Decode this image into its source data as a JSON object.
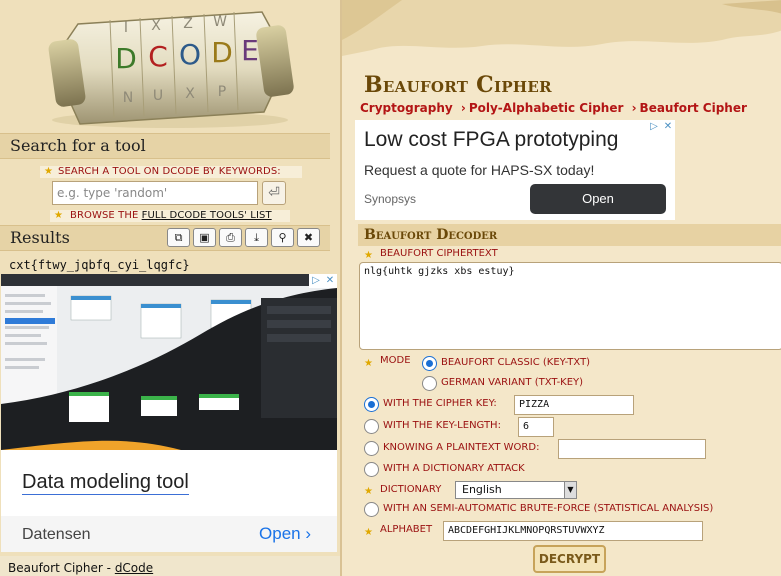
{
  "left": {
    "logo_text": "DCODE",
    "search_section": "Search for a tool",
    "search_keywords_label": "SEARCH A TOOL ON DCODE BY KEYWORDS:",
    "search_placeholder": "e.g. type 'random'",
    "browse_prefix": "BROWSE THE",
    "browse_link": "FULL DCODE TOOLS' LIST",
    "results_section": "Results",
    "result_value": "cxt{ftwy_jqbfq_cyi_lqgfc}",
    "footer_prefix": "Beaufort Cipher - ",
    "footer_link": "dCode"
  },
  "ad_left": {
    "title": "Data modeling tool",
    "brand": "Datensen",
    "open": "Open ›"
  },
  "right": {
    "title": "Beaufort Cipher",
    "breadcrumb": [
      "Cryptography",
      "Poly-Alphabetic Cipher",
      "Beaufort Cipher"
    ],
    "breadcrumb_sep": "›",
    "ad": {
      "title": "Low cost FPGA prototyping",
      "subtitle": "Request a quote for HAPS-SX today!",
      "brand": "Synopsys",
      "open": "Open"
    },
    "decoder": {
      "heading": "Beaufort Decoder",
      "ciphertext_label": "BEAUFORT CIPHERTEXT",
      "ciphertext_value": "nlg{uhtk gjzks xbs estuy}",
      "mode_label": "MODE",
      "mode_classic": "BEAUFORT CLASSIC (KEY-TXT)",
      "mode_german": "GERMAN VARIANT (TXT-KEY)",
      "with_key_label": "WITH THE CIPHER KEY:",
      "key_value": "PIZZA",
      "with_length_label": "WITH THE KEY-LENGTH:",
      "length_value": "6",
      "plaintext_label": "KNOWING A PLAINTEXT WORD:",
      "plaintext_value": "",
      "dictionary_attack_label": "WITH A DICTIONARY ATTACK",
      "dictionary_label": "DICTIONARY",
      "dictionary_value": "English",
      "bruteforce_label": "WITH AN SEMI-AUTOMATIC BRUTE-FORCE (STATISTICAL ANALYSIS)",
      "alphabet_label": "ALPHABET",
      "alphabet_value": "ABCDEFGHIJKLMNOPQRSTUVWXYZ",
      "decrypt_label": "DECRYPT"
    }
  },
  "colors": {
    "accent_red": "#b31515",
    "title_brown": "#6a4808",
    "radio_blue": "#1a6fd4"
  }
}
